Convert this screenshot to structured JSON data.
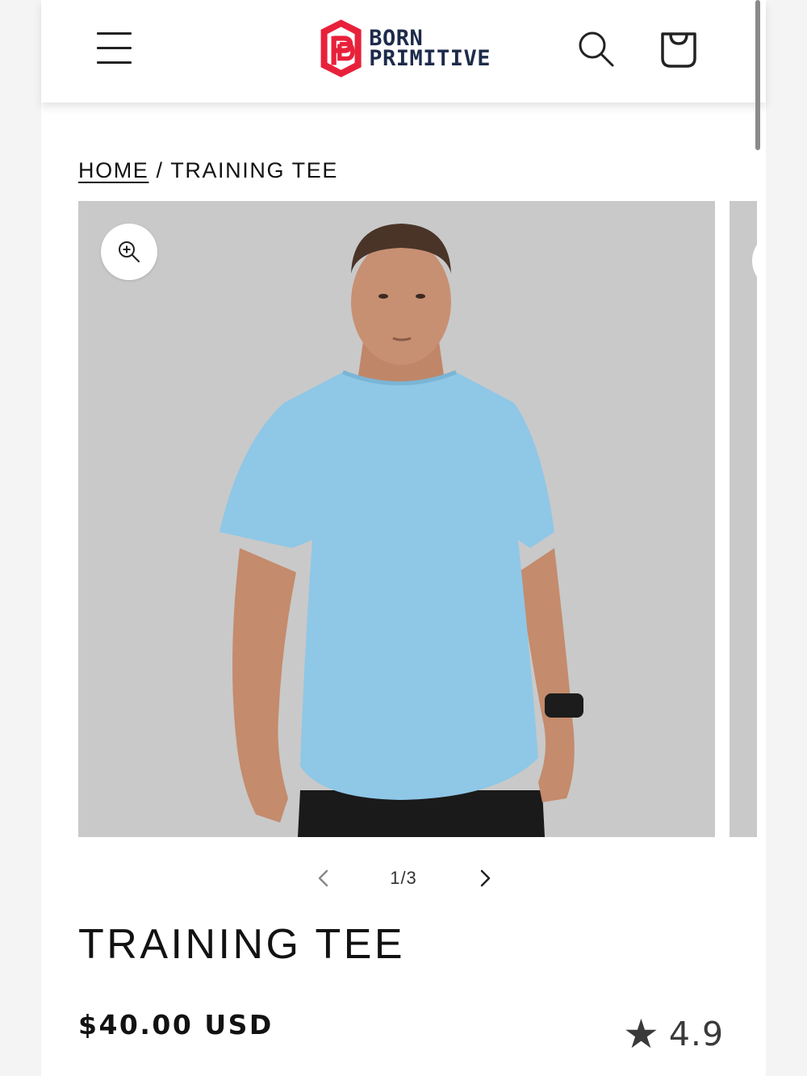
{
  "header": {
    "logo_line1": "BORN",
    "logo_line2": "PRIMITIVE",
    "logo_color": "#e8213a",
    "brand_text_color": "#1d2b4a",
    "icons": [
      "menu-icon",
      "search-icon",
      "cart-icon"
    ]
  },
  "breadcrumb": {
    "home": "HOME",
    "separator": "/",
    "current": "TRAINING TEE"
  },
  "media": {
    "background": "#c9c9c9",
    "shirt_color": "#8fc7e6",
    "counter": "1/3"
  },
  "product": {
    "title": "TRAINING TEE",
    "price": "$40.00 USD",
    "rating_star": "★",
    "rating": "4.9"
  }
}
